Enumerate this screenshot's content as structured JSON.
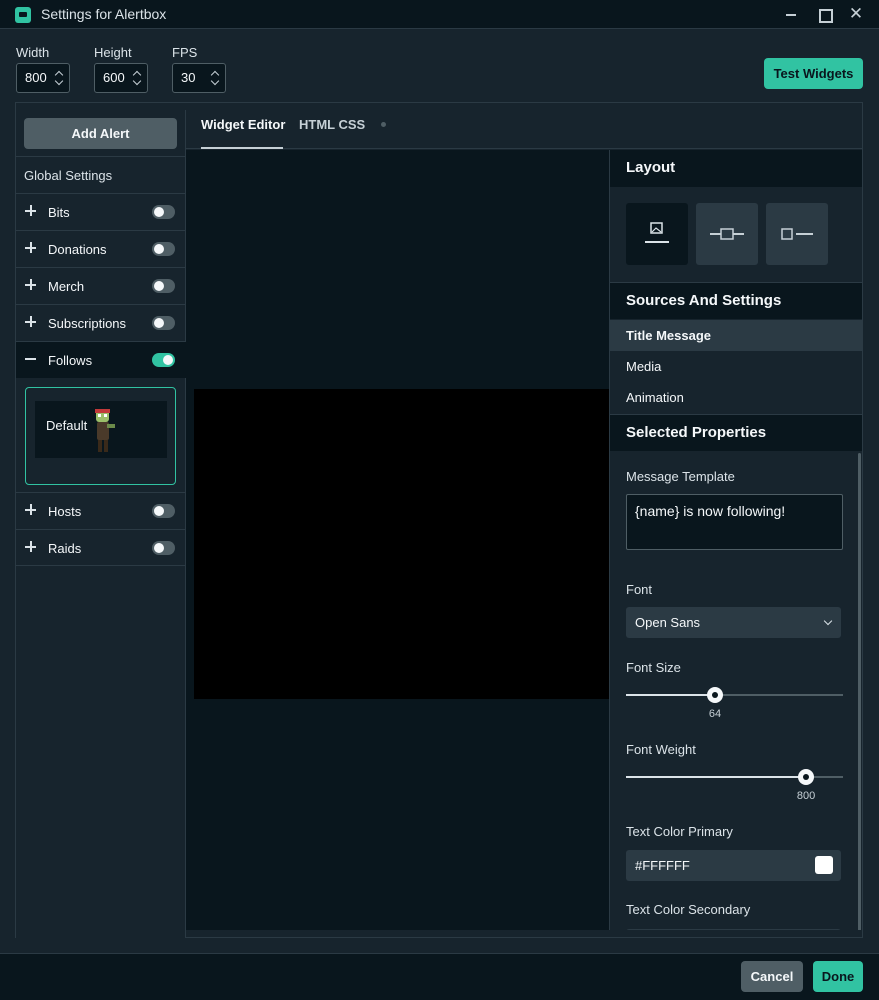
{
  "window": {
    "title": "Settings for Alertbox",
    "app_icon": "streamlabs-icon"
  },
  "dimensions": {
    "width": {
      "label": "Width",
      "value": "800"
    },
    "height": {
      "label": "Height",
      "value": "600"
    },
    "fps": {
      "label": "FPS",
      "value": "30"
    }
  },
  "toolbar": {
    "test_widgets_label": "Test Widgets"
  },
  "sidebar": {
    "add_alert_label": "Add Alert",
    "global_settings_label": "Global Settings",
    "items": [
      {
        "label": "Bits",
        "enabled": false,
        "expanded": false
      },
      {
        "label": "Donations",
        "enabled": false,
        "expanded": false
      },
      {
        "label": "Merch",
        "enabled": false,
        "expanded": false
      },
      {
        "label": "Subscriptions",
        "enabled": false,
        "expanded": false
      },
      {
        "label": "Follows",
        "enabled": true,
        "expanded": true
      },
      {
        "label": "Hosts",
        "enabled": false,
        "expanded": false
      },
      {
        "label": "Raids",
        "enabled": false,
        "expanded": false
      }
    ],
    "variation": {
      "label": "Default"
    }
  },
  "tabs": [
    {
      "label": "Widget Editor",
      "active": true
    },
    {
      "label": "HTML CSS",
      "active": false
    }
  ],
  "properties": {
    "layout": {
      "heading": "Layout",
      "options": [
        "image-above-text-icon",
        "text-over-image-icon",
        "image-beside-text-icon"
      ],
      "selected": 0
    },
    "sources": {
      "heading": "Sources And Settings",
      "items": [
        "Title Message",
        "Media",
        "Animation"
      ],
      "selected": 0
    },
    "selected": {
      "heading": "Selected Properties",
      "message_template_label": "Message Template",
      "message_template_value": "{name} is now following!",
      "font_label": "Font",
      "font_value": "Open Sans",
      "font_size_label": "Font Size",
      "font_size_value": "64",
      "font_size_fraction": 0.41,
      "font_weight_label": "Font Weight",
      "font_weight_value": "800",
      "font_weight_fraction": 0.83,
      "text_color_primary_label": "Text Color Primary",
      "text_color_primary_value": "#FFFFFF",
      "text_color_secondary_label": "Text Color Secondary"
    }
  },
  "footer": {
    "cancel_label": "Cancel",
    "done_label": "Done"
  },
  "colors": {
    "accent": "#31c3a2",
    "background": "#17242d",
    "dark": "#09161d",
    "border": "#2b3a44"
  }
}
